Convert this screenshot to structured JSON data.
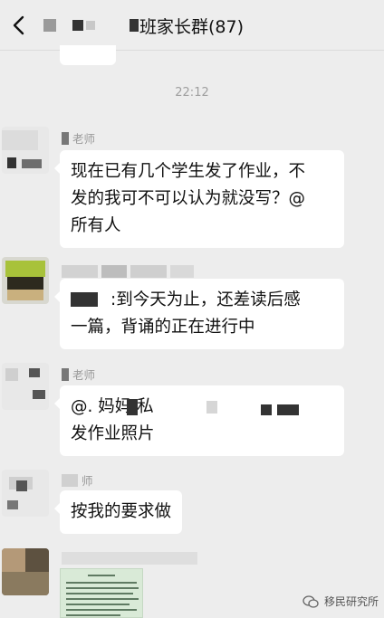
{
  "header": {
    "title": "班家长群(87)",
    "back_icon": "chevron-left-icon"
  },
  "chat": {
    "timestamp": "22:12",
    "messages": [
      {
        "sender": "老师",
        "lines": [
          "现在已有几个学生发了作业，不",
          "发的我可不可以认为就没写？@",
          "所有人"
        ]
      },
      {
        "sender": "",
        "lines": [
          ":到今天为止，还差读后感",
          "一篇，背诵的正在进行中"
        ]
      },
      {
        "sender": "老师",
        "lines": [
          "@.          妈妈                          私",
          "发作业照片"
        ]
      },
      {
        "sender": "师",
        "lines": [
          "按我的要求做"
        ]
      }
    ]
  },
  "watermark": {
    "text": "移民研究所"
  },
  "colors": {
    "background": "#ededed",
    "bubble": "#ffffff",
    "timestamp": "#9e9e9e"
  }
}
